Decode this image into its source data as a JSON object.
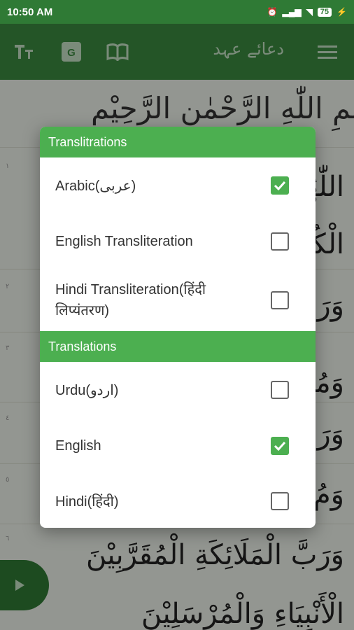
{
  "status_bar": {
    "time": "10:50 AM",
    "battery": "75"
  },
  "toolbar": {
    "title": "دعائے عہد",
    "icons": [
      "text-size-icon",
      "translate-icon",
      "book-icon",
      "menu-icon"
    ]
  },
  "background": {
    "bismillah": "بِسْمِ اللّٰهِ الرَّحْمٰنِ الرَّحِيْمِ",
    "lines": [
      "اللّٰهُمَّ",
      "الْكُرْسِيِّ",
      "وَرَبَّ",
      "وَمُنْزِلَ النُّوْرِ",
      "وَرَبَّ",
      "وَمُ",
      "وَرَبَّ الْمَلَائِكَةِ الْمُقَرَّبِيْنَ",
      "الْأَنْبِيَاءِ وَالْمُرْسَلِيْنَ"
    ],
    "verse_numbers": [
      "١",
      "٢",
      "٣",
      "٤",
      "٥",
      "٦"
    ]
  },
  "dialog": {
    "transliterations_header": "Translitrations",
    "transliterations": [
      {
        "label": "Arabic(عربی)",
        "checked": true
      },
      {
        "label": "English Transliteration",
        "checked": false
      },
      {
        "label": "Hindi Transliteration(हिंदी लिप्यंतरण)",
        "checked": false
      }
    ],
    "translations_header": "Translations",
    "translations": [
      {
        "label": "Urdu(اردو)",
        "checked": false
      },
      {
        "label": "English",
        "checked": true
      },
      {
        "label": "Hindi(हिंदी)",
        "checked": false
      }
    ]
  },
  "colors": {
    "primary": "#3b8a3f",
    "accent": "#4caf50",
    "status": "#2f7a35"
  }
}
